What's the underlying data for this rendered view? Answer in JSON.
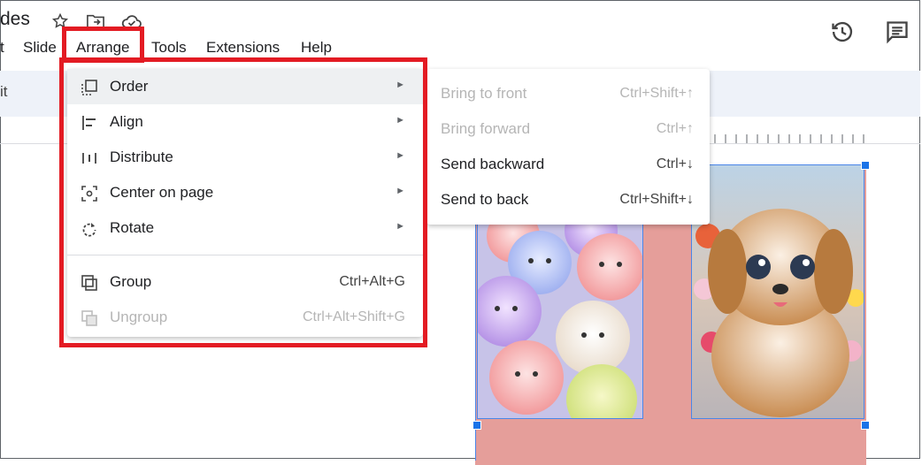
{
  "app": {
    "title_fragment": "des"
  },
  "menubar": {
    "items": [
      "t",
      "Slide",
      "Arrange",
      "Tools",
      "Extensions",
      "Help"
    ]
  },
  "toolbar": {
    "left_fragment": "it"
  },
  "arrange_menu": {
    "items": [
      {
        "label": "Order",
        "icon": "order-icon",
        "has_submenu": true,
        "highlighted": true
      },
      {
        "label": "Align",
        "icon": "align-icon",
        "has_submenu": true
      },
      {
        "label": "Distribute",
        "icon": "distribute-icon",
        "has_submenu": true
      },
      {
        "label": "Center on page",
        "icon": "center-on-page-icon",
        "has_submenu": true
      },
      {
        "label": "Rotate",
        "icon": "rotate-icon",
        "has_submenu": true
      }
    ],
    "group_items": [
      {
        "label": "Group",
        "icon": "group-icon",
        "shortcut": "Ctrl+Alt+G",
        "disabled": false
      },
      {
        "label": "Ungroup",
        "icon": "ungroup-icon",
        "shortcut": "Ctrl+Alt+Shift+G",
        "disabled": true
      }
    ]
  },
  "order_submenu": {
    "items": [
      {
        "label": "Bring to front",
        "shortcut": "Ctrl+Shift+↑",
        "disabled": true
      },
      {
        "label": "Bring forward",
        "shortcut": "Ctrl+↑",
        "disabled": true
      },
      {
        "label": "Send backward",
        "shortcut": "Ctrl+↓",
        "disabled": false
      },
      {
        "label": "Send to back",
        "shortcut": "Ctrl+Shift+↓",
        "disabled": false
      }
    ]
  },
  "icons": {
    "star": "star-icon",
    "move_to_folder": "move-to-folder-icon",
    "cloud_saved": "cloud-saved-icon",
    "version_history": "history-icon",
    "comments": "comment-icon"
  },
  "colors": {
    "highlight_box": "#e31b23",
    "selection": "#1a73e8",
    "slide_background": "#e59e9a",
    "toolbar_background": "#eef2f9"
  }
}
